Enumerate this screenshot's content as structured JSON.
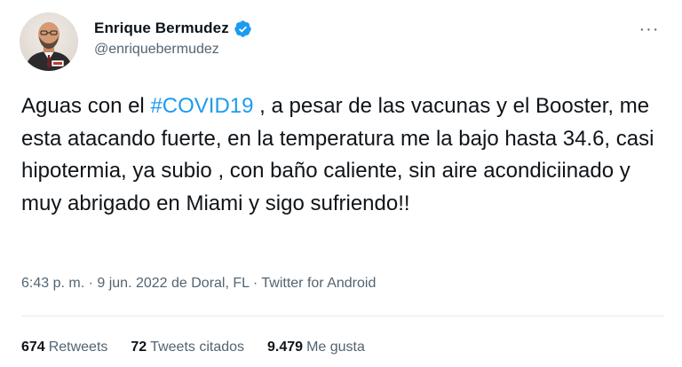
{
  "author": {
    "display_name": "Enrique Bermudez",
    "handle": "@enriquebermudez",
    "verified": true,
    "verified_color": "#1d9bf0",
    "avatar_icon": "profile-photo"
  },
  "menu": {
    "more_label": "···"
  },
  "tweet": {
    "text_before": "Aguas con el ",
    "hashtag": "#COVID19",
    "text_after": " , a pesar de las vacunas y el Booster, me esta atacando fuerte, en la temperatura me la bajo hasta 34.6, casi hipotermia, ya subio , con baño caliente, sin aire acondiciinado y muy abrigado en Miami y sigo sufriendo!!",
    "hashtag_color": "#1d9bf0"
  },
  "meta": {
    "time": "6:43 p. m.",
    "sep1": " · ",
    "date": "9 jun. 2022",
    "location_prefix": " de ",
    "location": "Doral, FL",
    "sep2": " · ",
    "source": "Twitter for Android"
  },
  "stats": {
    "retweets_count": "674",
    "retweets_label": "Retweets",
    "quotes_count": "72",
    "quotes_label": "Tweets citados",
    "likes_count": "9.479",
    "likes_label": "Me gusta"
  }
}
